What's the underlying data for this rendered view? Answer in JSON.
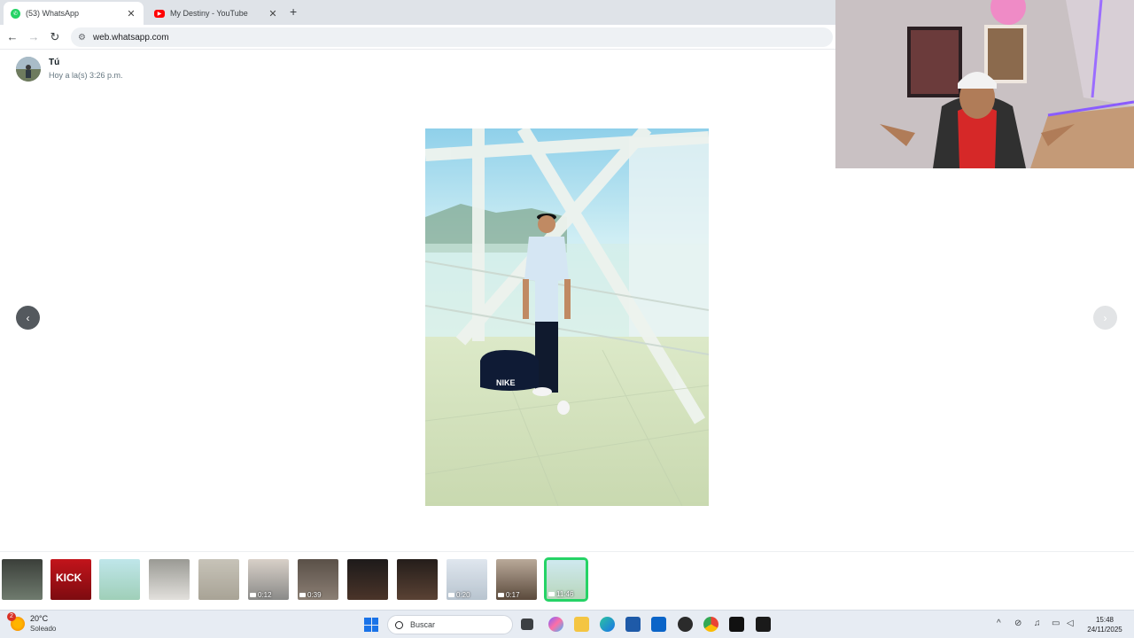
{
  "browser": {
    "tabs": [
      {
        "favicon_icon": "whatsapp-icon",
        "label": "(53) WhatsApp",
        "active": true
      },
      {
        "favicon_icon": "youtube-icon",
        "label": "My Destiny - YouTube",
        "active": false
      }
    ],
    "close_symbol": "✕",
    "new_tab_symbol": "+",
    "url": "web.whatsapp.com"
  },
  "viewer": {
    "sender_name": "Tú",
    "sender_time": "Hoy a la(s) 3:26 p.m.",
    "prev_symbol": "‹",
    "next_symbol": "›",
    "photo_logo_text": "NIKE"
  },
  "thumbnails": [
    {
      "kind": "image",
      "duration": ""
    },
    {
      "kind": "image",
      "duration": "",
      "text": "KICK"
    },
    {
      "kind": "image",
      "duration": ""
    },
    {
      "kind": "image",
      "duration": ""
    },
    {
      "kind": "image",
      "duration": ""
    },
    {
      "kind": "video",
      "duration": "0:12"
    },
    {
      "kind": "video",
      "duration": "0:39"
    },
    {
      "kind": "image",
      "duration": ""
    },
    {
      "kind": "image",
      "duration": ""
    },
    {
      "kind": "video",
      "duration": "0:20"
    },
    {
      "kind": "video",
      "duration": "0:17"
    },
    {
      "kind": "video",
      "duration": "11:46",
      "selected": true
    }
  ],
  "taskbar": {
    "weather_badge": "2",
    "temperature": "20°C",
    "condition": "Soleado",
    "search_placeholder": "Buscar",
    "time": "15:48",
    "date": "24/11/2025"
  },
  "colors": {
    "whatsapp_green": "#25d366",
    "youtube_red": "#ff0000",
    "tabstrip": "#dfe3e8"
  }
}
